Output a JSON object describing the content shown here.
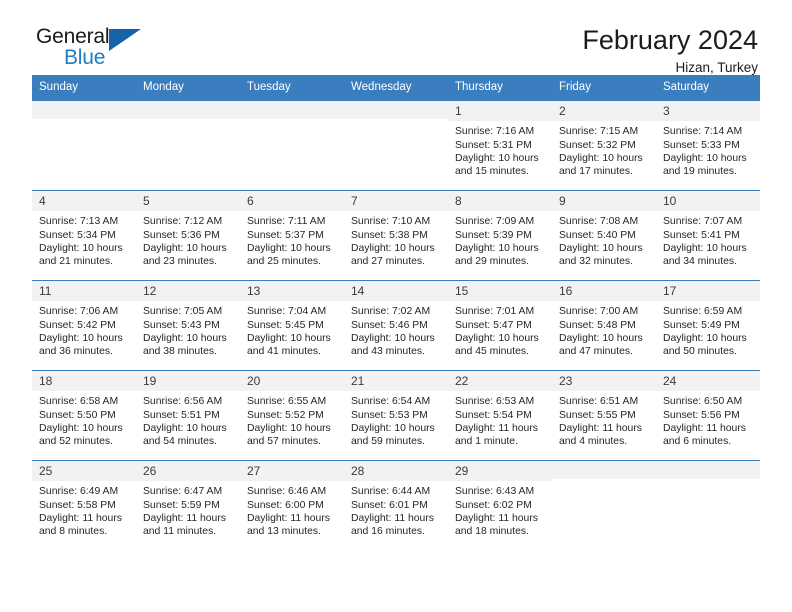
{
  "brand": {
    "name_part1": "General",
    "name_part2": "Blue"
  },
  "header": {
    "month_title": "February 2024",
    "location": "Hizan, Turkey"
  },
  "colors": {
    "header_blue": "#3a7ec0",
    "brand_blue": "#1d7ec4",
    "logo_triangle": "#1663a6",
    "daynum_bg": "#f2f2f2"
  },
  "calendar": {
    "weekday_headers": [
      "Sunday",
      "Monday",
      "Tuesday",
      "Wednesday",
      "Thursday",
      "Friday",
      "Saturday"
    ],
    "weeks": [
      [
        {
          "day": "",
          "empty": true
        },
        {
          "day": "",
          "empty": true
        },
        {
          "day": "",
          "empty": true
        },
        {
          "day": "",
          "empty": true
        },
        {
          "day": "1",
          "sunrise": "Sunrise: 7:16 AM",
          "sunset": "Sunset: 5:31 PM",
          "daylight": "Daylight: 10 hours and 15 minutes."
        },
        {
          "day": "2",
          "sunrise": "Sunrise: 7:15 AM",
          "sunset": "Sunset: 5:32 PM",
          "daylight": "Daylight: 10 hours and 17 minutes."
        },
        {
          "day": "3",
          "sunrise": "Sunrise: 7:14 AM",
          "sunset": "Sunset: 5:33 PM",
          "daylight": "Daylight: 10 hours and 19 minutes."
        }
      ],
      [
        {
          "day": "4",
          "sunrise": "Sunrise: 7:13 AM",
          "sunset": "Sunset: 5:34 PM",
          "daylight": "Daylight: 10 hours and 21 minutes."
        },
        {
          "day": "5",
          "sunrise": "Sunrise: 7:12 AM",
          "sunset": "Sunset: 5:36 PM",
          "daylight": "Daylight: 10 hours and 23 minutes."
        },
        {
          "day": "6",
          "sunrise": "Sunrise: 7:11 AM",
          "sunset": "Sunset: 5:37 PM",
          "daylight": "Daylight: 10 hours and 25 minutes."
        },
        {
          "day": "7",
          "sunrise": "Sunrise: 7:10 AM",
          "sunset": "Sunset: 5:38 PM",
          "daylight": "Daylight: 10 hours and 27 minutes."
        },
        {
          "day": "8",
          "sunrise": "Sunrise: 7:09 AM",
          "sunset": "Sunset: 5:39 PM",
          "daylight": "Daylight: 10 hours and 29 minutes."
        },
        {
          "day": "9",
          "sunrise": "Sunrise: 7:08 AM",
          "sunset": "Sunset: 5:40 PM",
          "daylight": "Daylight: 10 hours and 32 minutes."
        },
        {
          "day": "10",
          "sunrise": "Sunrise: 7:07 AM",
          "sunset": "Sunset: 5:41 PM",
          "daylight": "Daylight: 10 hours and 34 minutes."
        }
      ],
      [
        {
          "day": "11",
          "sunrise": "Sunrise: 7:06 AM",
          "sunset": "Sunset: 5:42 PM",
          "daylight": "Daylight: 10 hours and 36 minutes."
        },
        {
          "day": "12",
          "sunrise": "Sunrise: 7:05 AM",
          "sunset": "Sunset: 5:43 PM",
          "daylight": "Daylight: 10 hours and 38 minutes."
        },
        {
          "day": "13",
          "sunrise": "Sunrise: 7:04 AM",
          "sunset": "Sunset: 5:45 PM",
          "daylight": "Daylight: 10 hours and 41 minutes."
        },
        {
          "day": "14",
          "sunrise": "Sunrise: 7:02 AM",
          "sunset": "Sunset: 5:46 PM",
          "daylight": "Daylight: 10 hours and 43 minutes."
        },
        {
          "day": "15",
          "sunrise": "Sunrise: 7:01 AM",
          "sunset": "Sunset: 5:47 PM",
          "daylight": "Daylight: 10 hours and 45 minutes."
        },
        {
          "day": "16",
          "sunrise": "Sunrise: 7:00 AM",
          "sunset": "Sunset: 5:48 PM",
          "daylight": "Daylight: 10 hours and 47 minutes."
        },
        {
          "day": "17",
          "sunrise": "Sunrise: 6:59 AM",
          "sunset": "Sunset: 5:49 PM",
          "daylight": "Daylight: 10 hours and 50 minutes."
        }
      ],
      [
        {
          "day": "18",
          "sunrise": "Sunrise: 6:58 AM",
          "sunset": "Sunset: 5:50 PM",
          "daylight": "Daylight: 10 hours and 52 minutes."
        },
        {
          "day": "19",
          "sunrise": "Sunrise: 6:56 AM",
          "sunset": "Sunset: 5:51 PM",
          "daylight": "Daylight: 10 hours and 54 minutes."
        },
        {
          "day": "20",
          "sunrise": "Sunrise: 6:55 AM",
          "sunset": "Sunset: 5:52 PM",
          "daylight": "Daylight: 10 hours and 57 minutes."
        },
        {
          "day": "21",
          "sunrise": "Sunrise: 6:54 AM",
          "sunset": "Sunset: 5:53 PM",
          "daylight": "Daylight: 10 hours and 59 minutes."
        },
        {
          "day": "22",
          "sunrise": "Sunrise: 6:53 AM",
          "sunset": "Sunset: 5:54 PM",
          "daylight": "Daylight: 11 hours and 1 minute."
        },
        {
          "day": "23",
          "sunrise": "Sunrise: 6:51 AM",
          "sunset": "Sunset: 5:55 PM",
          "daylight": "Daylight: 11 hours and 4 minutes."
        },
        {
          "day": "24",
          "sunrise": "Sunrise: 6:50 AM",
          "sunset": "Sunset: 5:56 PM",
          "daylight": "Daylight: 11 hours and 6 minutes."
        }
      ],
      [
        {
          "day": "25",
          "sunrise": "Sunrise: 6:49 AM",
          "sunset": "Sunset: 5:58 PM",
          "daylight": "Daylight: 11 hours and 8 minutes."
        },
        {
          "day": "26",
          "sunrise": "Sunrise: 6:47 AM",
          "sunset": "Sunset: 5:59 PM",
          "daylight": "Daylight: 11 hours and 11 minutes."
        },
        {
          "day": "27",
          "sunrise": "Sunrise: 6:46 AM",
          "sunset": "Sunset: 6:00 PM",
          "daylight": "Daylight: 11 hours and 13 minutes."
        },
        {
          "day": "28",
          "sunrise": "Sunrise: 6:44 AM",
          "sunset": "Sunset: 6:01 PM",
          "daylight": "Daylight: 11 hours and 16 minutes."
        },
        {
          "day": "29",
          "sunrise": "Sunrise: 6:43 AM",
          "sunset": "Sunset: 6:02 PM",
          "daylight": "Daylight: 11 hours and 18 minutes."
        },
        {
          "day": "",
          "empty": true
        },
        {
          "day": "",
          "empty": true
        }
      ]
    ]
  }
}
